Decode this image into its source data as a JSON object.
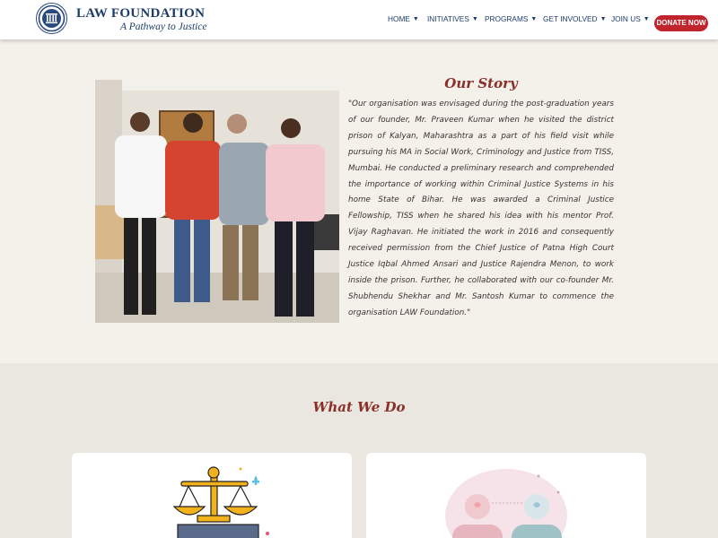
{
  "header": {
    "brand_name": "LAW FOUNDATION",
    "tagline": "A Pathway to Justice",
    "nav": [
      {
        "label": "HOME"
      },
      {
        "label": "INITIATIVES"
      },
      {
        "label": "PROGRAMS"
      },
      {
        "label": "GET INVOLVED"
      },
      {
        "label": "JOIN US"
      }
    ],
    "donate_label": "DONATE NOW",
    "brand_color": "#1d3c6b",
    "accent_color": "#c0242c"
  },
  "story": {
    "title": "Our Story",
    "text": "\"Our organisation was envisaged during the post-graduation years of our founder, Mr. Praveen Kumar when he visited the district prison of Kalyan, Maharashtra as a part of his field visit while pursuing his MA in Social Work, Criminology and Justice from TISS, Mumbai. He conducted a preliminary research and comprehended the importance of working within Criminal Justice Systems in his home State of Bihar. He was awarded a Criminal Justice Fellowship, TISS when he shared his idea with his mentor Prof. Vijay Raghavan. He initiated the work in 2016 and consequently received permission from the Chief Justice of Patna High Court Justice Iqbal Ahmed Ansari and Justice Rajendra Menon, to work inside the prison. Further, he collaborated with our co-founder Mr. Shubhendu Shekhar and Mr. Santosh Kumar to commence the organisation LAW Foundation.\"",
    "title_color": "#8b2f2a"
  },
  "what_we_do": {
    "title": "What We Do",
    "cards": [
      {
        "icon": "scales-of-justice-icon"
      },
      {
        "icon": "minds-connection-icon"
      }
    ]
  }
}
